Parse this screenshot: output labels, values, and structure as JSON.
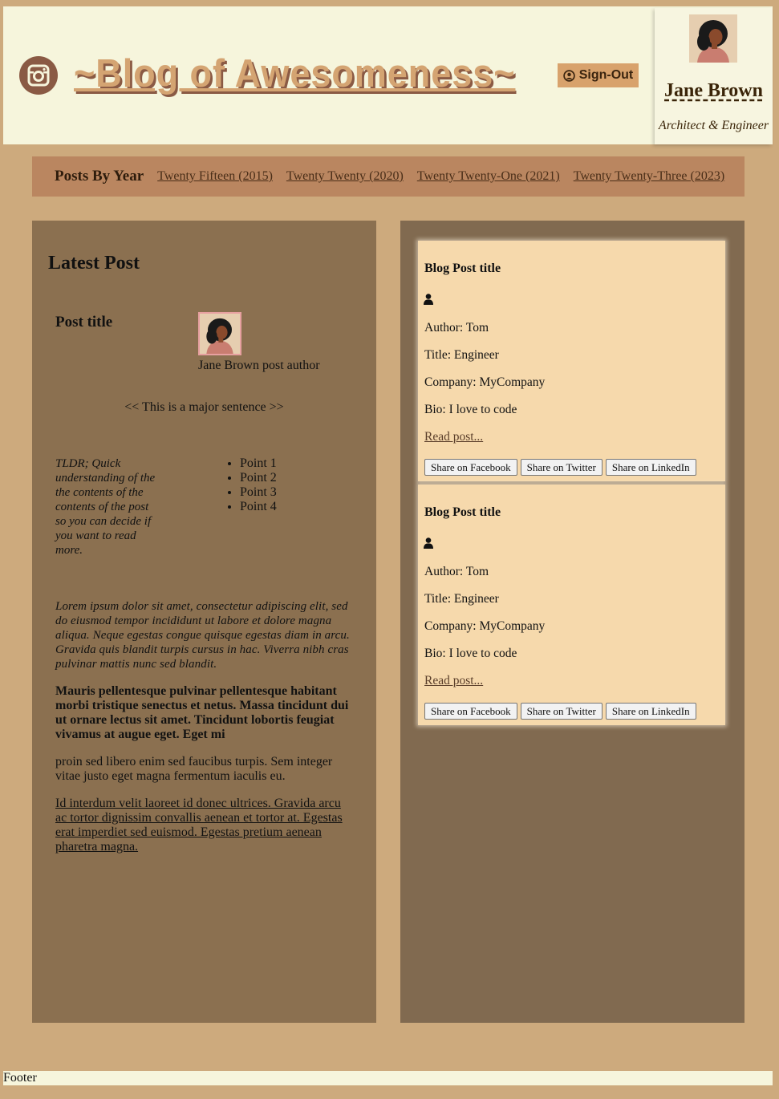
{
  "header": {
    "site_title": "~Blog of Awesomeness~",
    "signout_label": "Sign-Out",
    "profile": {
      "name": "Jane Brown",
      "role": "Architect & Engineer"
    }
  },
  "nav": {
    "title": "Posts By Year",
    "links": [
      "Twenty Fifteen (2015)",
      "Twenty Twenty (2020)",
      "Twenty Twenty-One (2021)",
      "Twenty Twenty-Three (2023)"
    ]
  },
  "latest": {
    "heading": "Latest Post",
    "post_title": "Post title",
    "author_caption": "Jane Brown post author",
    "major_sentence": "<< This is a major sentence >>",
    "tldr": "TLDR; Quick understanding of the the contents of the contents of the post so you can decide if you want to read more.",
    "points": [
      "Point 1",
      "Point 2",
      "Point 3",
      "Point 4"
    ],
    "para_italic": "Lorem ipsum dolor sit amet, consectetur adipiscing elit, sed do eiusmod tempor incididunt ut labore et dolore magna aliqua. Neque egestas congue quisque egestas diam in arcu. Gravida quis blandit turpis cursus in hac. Viverra nibh cras pulvinar mattis nunc sed blandit.",
    "para_bold": "Mauris pellentesque pulvinar pellentesque habitant morbi tristique senectus et netus. Massa tincidunt dui ut ornare lectus sit amet. Tincidunt lobortis feugiat vivamus at augue eget. Eget mi",
    "para_plain": "proin sed libero enim sed faucibus turpis. Sem integer vitae justo eget magna fermentum iaculis eu.",
    "para_link": "Id interdum velit laoreet id donec ultrices. Gravida arcu ac tortor dignissim convallis aenean et tortor at. Egestas erat imperdiet sed euismod. Egestas pretium aenean pharetra magna."
  },
  "cards": [
    {
      "title": "Blog Post title",
      "author": "Author: Tom",
      "job": "Title: Engineer",
      "company": "Company: MyCompany",
      "bio": "Bio: I love to code",
      "read_more": "Read post...",
      "share": [
        "Share on Facebook",
        "Share on Twitter",
        "Share on LinkedIn"
      ]
    },
    {
      "title": "Blog Post title",
      "author": "Author: Tom",
      "job": "Title: Engineer",
      "company": "Company: MyCompany",
      "bio": "Bio: I love to code",
      "read_more": "Read post...",
      "share": [
        "Share on Facebook",
        "Share on Twitter",
        "Share on LinkedIn"
      ]
    }
  ],
  "footer": {
    "text": "Footer"
  },
  "icons": {
    "brand": "instagram-icon",
    "signout": "user-circle-icon",
    "card_author": "user-icon"
  },
  "colors": {
    "page_bg": "#cdaa7d",
    "header_bg": "#f6f5dc",
    "title_color": "#d4a472",
    "nav_bg": "#ba8660",
    "left_panel": "#8b7050",
    "right_panel": "#816a50",
    "card_bg": "#f6d9ac"
  }
}
